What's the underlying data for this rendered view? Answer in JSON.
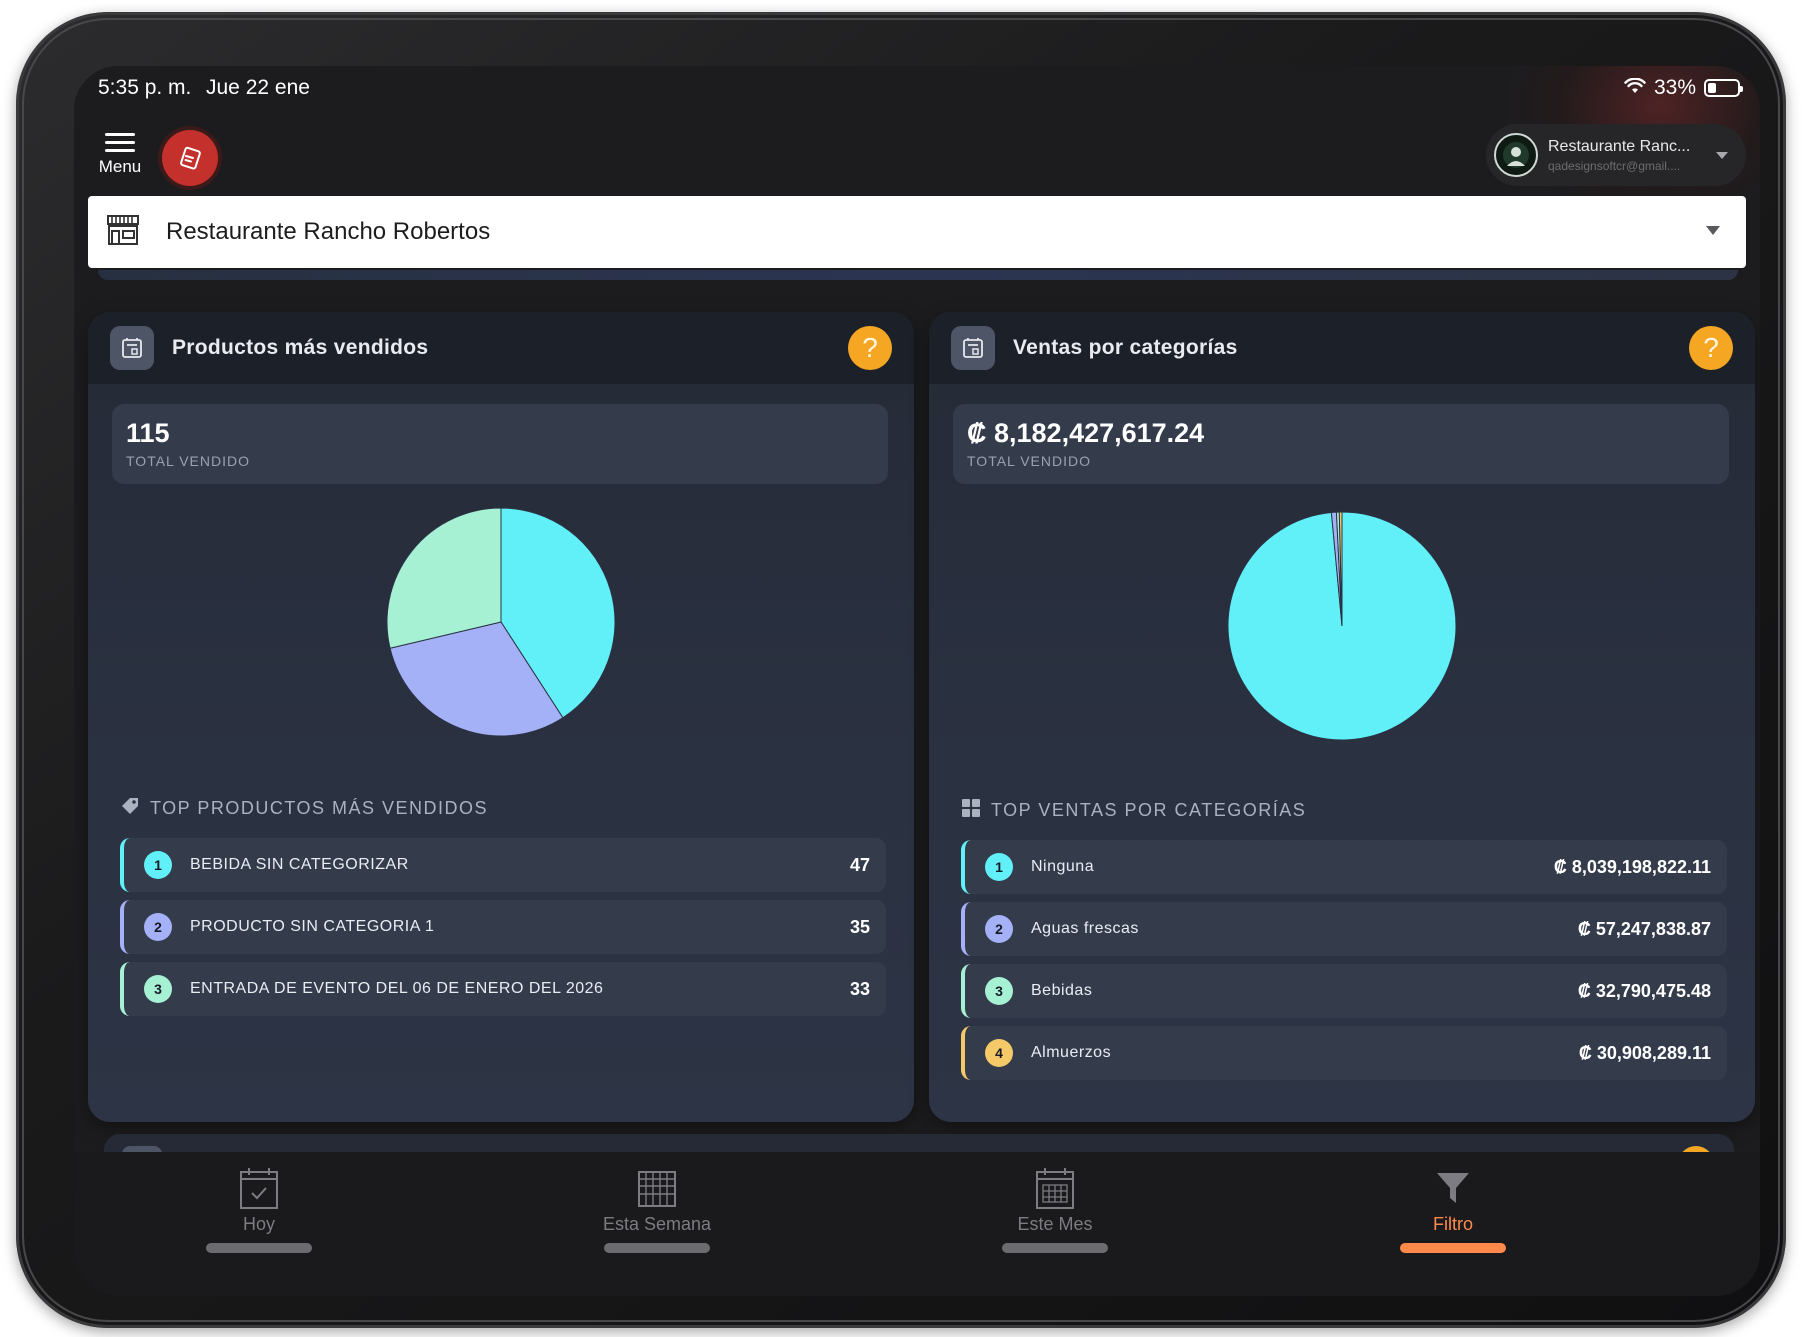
{
  "status_bar": {
    "time": "5:35 p. m.",
    "date": "Jue 22 ene",
    "battery": "33%"
  },
  "header": {
    "menu_label": "Menu",
    "account_name": "Restaurante Ranc...",
    "account_email": "qadesignsoftcr@gmail...."
  },
  "store_selector": {
    "value": "Restaurante Rancho Robertos"
  },
  "cards": {
    "products": {
      "title": "Productos más vendidos",
      "total_value": "115",
      "total_label": "TOTAL VENDIDO",
      "list_title": "TOP PRODUCTOS MÁS VENDIDOS",
      "items": [
        {
          "rank": "1",
          "name": "BEBIDA SIN CATEGORIZAR",
          "value": "47"
        },
        {
          "rank": "2",
          "name": "PRODUCTO SIN CATEGORIA 1",
          "value": "35"
        },
        {
          "rank": "3",
          "name": "ENTRADA DE EVENTO DEL 06 DE ENERO DEL 2026",
          "value": "33"
        }
      ]
    },
    "categories": {
      "title": "Ventas por categorías",
      "total_value": "₡ 8,182,427,617.24",
      "total_label": "TOTAL VENDIDO",
      "list_title": "TOP VENTAS POR CATEGORÍAS",
      "items": [
        {
          "rank": "1",
          "name": "Ninguna",
          "value": "₡ 8,039,198,822.11"
        },
        {
          "rank": "2",
          "name": "Aguas frescas",
          "value": "₡ 57,247,838.87"
        },
        {
          "rank": "3",
          "name": "Bebidas",
          "value": "₡ 32,790,475.48"
        },
        {
          "rank": "4",
          "name": "Almuerzos",
          "value": "₡ 30,908,289.11"
        }
      ]
    }
  },
  "chart_data": [
    {
      "type": "pie",
      "categories": [
        "BEBIDA SIN CATEGORIZAR",
        "PRODUCTO SIN CATEGORIA 1",
        "ENTRADA DE EVENTO DEL 06 DE ENERO DEL 2026"
      ],
      "values": [
        47,
        35,
        33
      ],
      "colors": [
        "#62f0f8",
        "#a4b1f7",
        "#a6f1d3"
      ]
    },
    {
      "type": "pie",
      "categories": [
        "Ninguna",
        "Aguas frescas",
        "Bebidas",
        "Almuerzos"
      ],
      "values": [
        8039198822.11,
        57247838.87,
        32790475.48,
        30908289.11
      ],
      "colors": [
        "#62f0f8",
        "#a4b1f7",
        "#a6f1d3",
        "#f5c968"
      ]
    }
  ],
  "rank_colors": [
    "#62f0f8",
    "#a4b1f7",
    "#a6f1d3",
    "#f5c968"
  ],
  "bottom_nav": [
    {
      "label": "Hoy",
      "icon": "calendar-check-icon",
      "active": false
    },
    {
      "label": "Esta Semana",
      "icon": "calendar-week-icon",
      "active": false
    },
    {
      "label": "Este Mes",
      "icon": "calendar-month-icon",
      "active": false
    },
    {
      "label": "Filtro",
      "icon": "filter-icon",
      "active": true
    }
  ],
  "colors": {
    "accent_orange": "#ff8a4c",
    "help_yellow": "#f5a623",
    "logo_red": "#c4302b"
  }
}
